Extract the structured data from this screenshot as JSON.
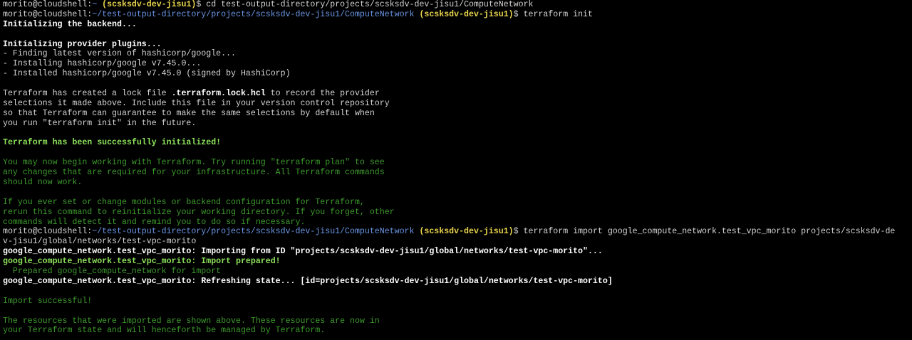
{
  "terminal": {
    "prompt_user": "morito@cloudshell:",
    "prompt_home": "~",
    "prompt_path": "~/test-output-directory/projects/scsksdv-dev-jisu1/ComputeNetwork",
    "project_tag": "(scsksdv-dev-jisu1)",
    "prompt_symbol": "$",
    "cmd_cd": " cd test-output-directory/projects/scsksdv-dev-jisu1/ComputeNetwork",
    "cmd_init": " terraform init",
    "init_backend": "Initializing the backend...",
    "init_plugins": "Initializing provider plugins...",
    "plugin_lines": [
      "- Finding latest version of hashicorp/google...",
      "- Installing hashicorp/google v7.45.0...",
      "- Installed hashicorp/google v7.45.0 (signed by HashiCorp)"
    ],
    "lock_pre": "Terraform has created a lock file ",
    "lock_file": ".terraform.lock.hcl",
    "lock_post": " to record the provider",
    "lock_lines": [
      "selections it made above. Include this file in your version control repository",
      "so that Terraform can guarantee to make the same selections by default when",
      "you run \"terraform init\" in the future."
    ],
    "init_success": "Terraform has been successfully initialized!",
    "begin_lines": [
      "You may now begin working with Terraform. Try running \"terraform plan\" to see",
      "any changes that are required for your infrastructure. All Terraform commands",
      "should now work."
    ],
    "modules_lines": [
      "If you ever set or change modules or backend configuration for Terraform,",
      "rerun this command to reinitialize your working directory. If you forget, other",
      "commands will detect it and remind you to do so if necessary."
    ],
    "cmd_import": " terraform import google_compute_network.test_vpc_morito projects/scsksdv-de",
    "cmd_import_wrap": "v-jisu1/global/networks/test-vpc-morito",
    "import_importing": "google_compute_network.test_vpc_morito: Importing from ID \"projects/scsksdv-dev-jisu1/global/networks/test-vpc-morito\"...",
    "import_prepared": "google_compute_network.test_vpc_morito: Import prepared!",
    "import_prepared_detail": "  Prepared google_compute_network for import",
    "import_refreshing": "google_compute_network.test_vpc_morito: Refreshing state... [id=projects/scsksdv-dev-jisu1/global/networks/test-vpc-morito]",
    "import_success": "Import successful!",
    "imported_lines": [
      "The resources that were imported are shown above. These resources are now in",
      "your Terraform state and will henceforth be managed by Terraform."
    ]
  }
}
